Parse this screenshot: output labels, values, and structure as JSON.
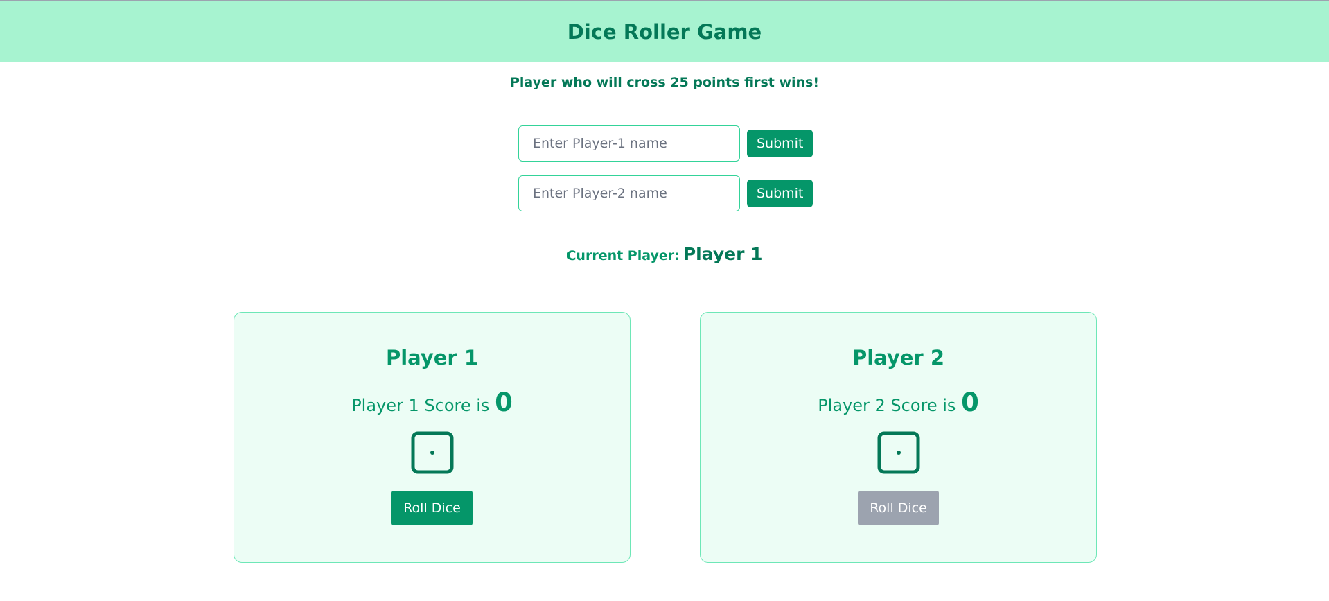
{
  "header": {
    "title": "Dice Roller Game"
  },
  "subtitle": "Player who will cross 25 points first wins!",
  "form": {
    "player1": {
      "placeholder": "Enter Player-1 name",
      "value": "",
      "submit_label": "Submit"
    },
    "player2": {
      "placeholder": "Enter Player-2 name",
      "value": "",
      "submit_label": "Submit"
    }
  },
  "current_player": {
    "label": "Current Player:",
    "value": "Player 1"
  },
  "players": [
    {
      "title": "Player 1",
      "score_text": "Player 1 Score is",
      "score": "0",
      "dice_value": 1,
      "roll_label": "Roll Dice",
      "roll_enabled": true
    },
    {
      "title": "Player 2",
      "score_text": "Player 2 Score is",
      "score": "0",
      "dice_value": 1,
      "roll_label": "Roll Dice",
      "roll_enabled": false
    }
  ],
  "colors": {
    "accent": "#059669",
    "accent_dark": "#047857",
    "header_bg": "#a7f3d0",
    "card_bg": "#ecfdf5",
    "disabled": "#9ca3af"
  },
  "icons": {
    "dice": "dice-one-icon"
  }
}
